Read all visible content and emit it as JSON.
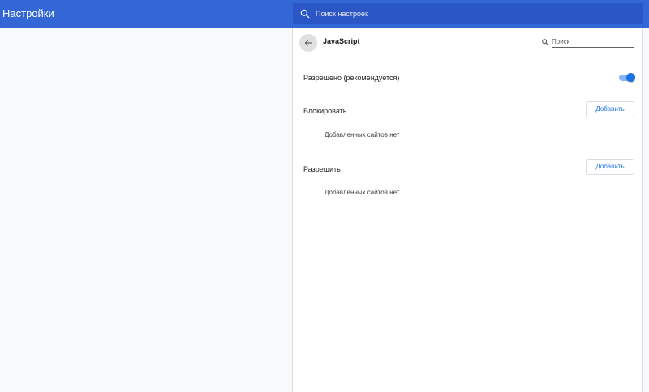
{
  "header": {
    "title": "Настройки",
    "search_placeholder": "Поиск настроек"
  },
  "page": {
    "title": "JavaScript",
    "search_placeholder": "Поиск"
  },
  "default_setting": {
    "label": "Разрешено (рекомендуется)",
    "enabled": true
  },
  "block_section": {
    "title": "Блокировать",
    "add_label": "Добавить",
    "empty_text": "Добавленных сайтов нет"
  },
  "allow_section": {
    "title": "Разрешить",
    "add_label": "Добавить",
    "empty_text": "Добавленных сайтов нет"
  },
  "colors": {
    "header_bg": "#3367d6",
    "search_bg": "#2a56c6",
    "accent": "#1a73e8",
    "toggle_track": "#8ab4f8"
  },
  "icons": {
    "header_search": "search-icon",
    "back": "arrow-back-icon",
    "page_search": "search-icon"
  }
}
